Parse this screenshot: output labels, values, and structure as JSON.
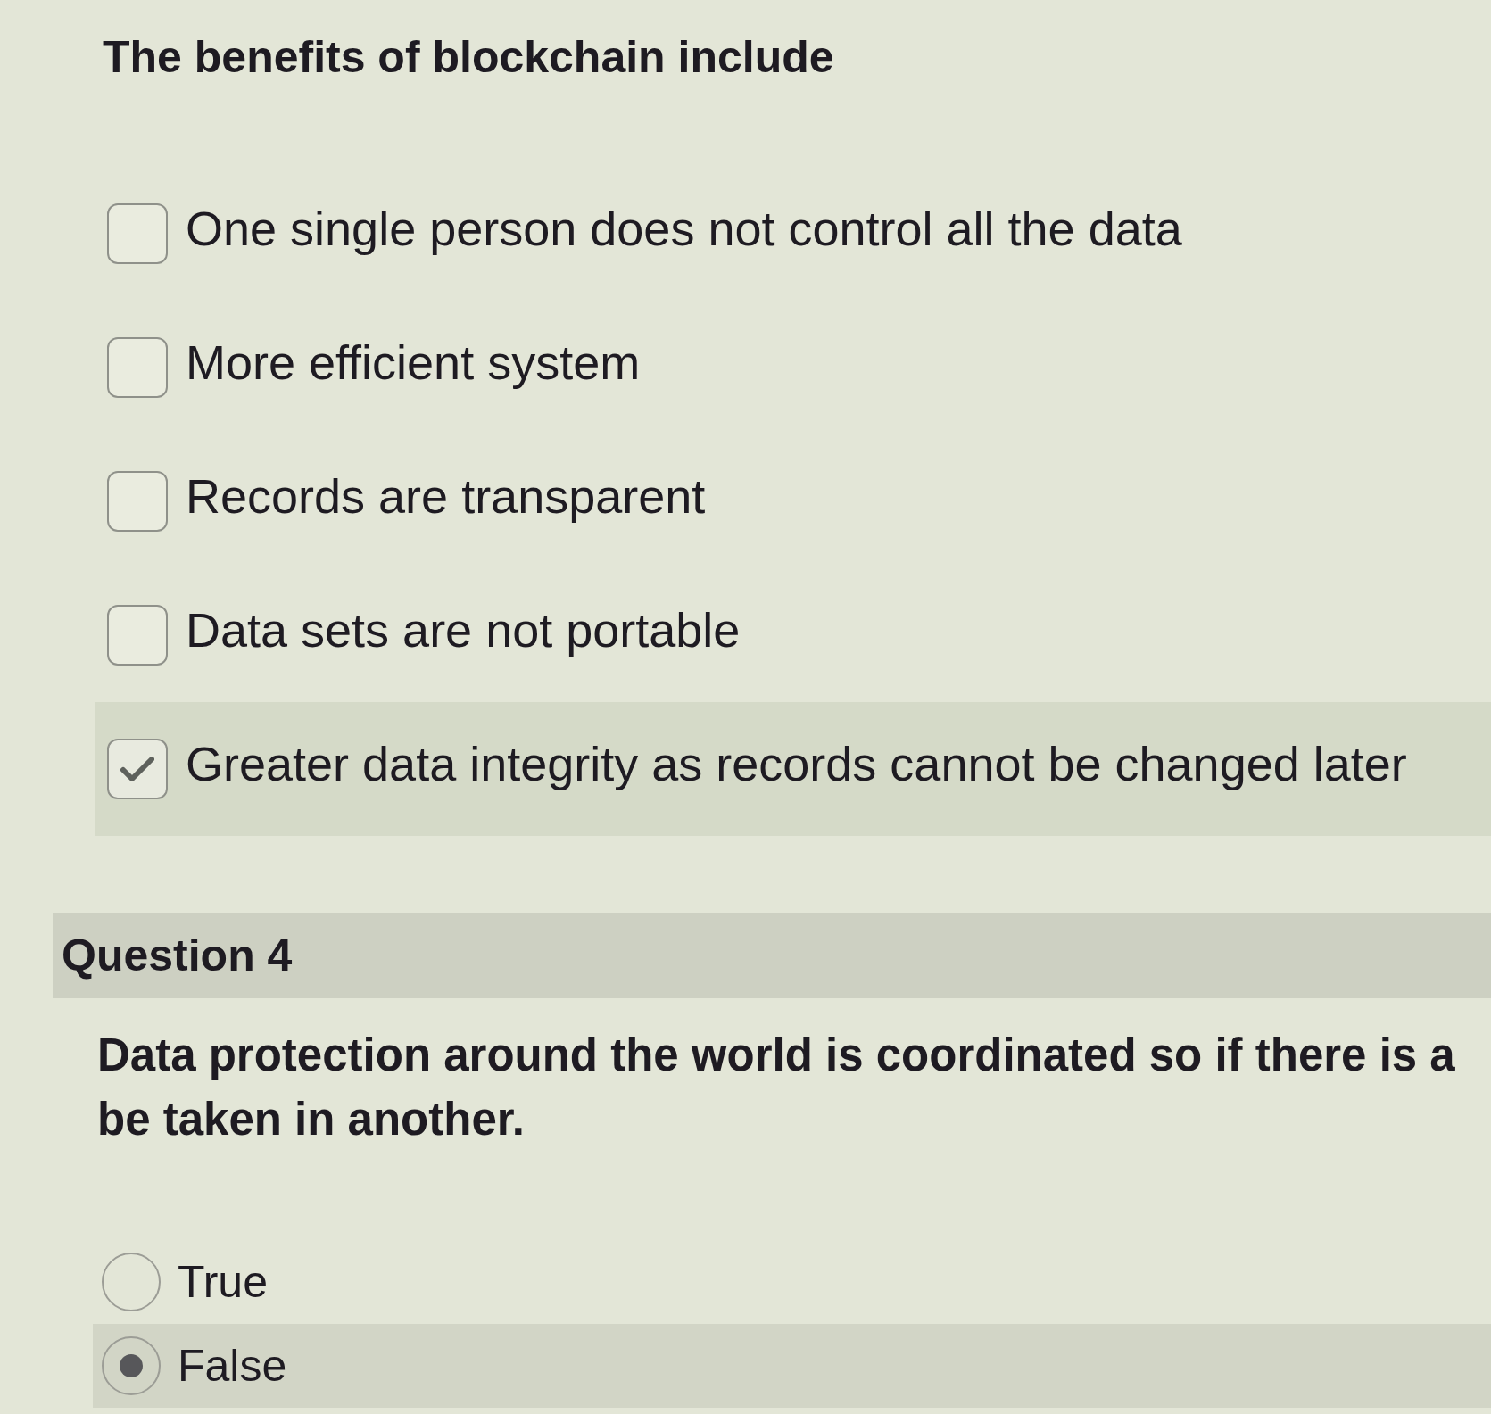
{
  "question_3": {
    "prompt": "The benefits of blockchain include",
    "options": [
      {
        "label": "One single person does not control all the data",
        "checked": false
      },
      {
        "label": "More efficient system",
        "checked": false
      },
      {
        "label": "Records are transparent",
        "checked": false
      },
      {
        "label": "Data sets are not portable",
        "checked": false
      },
      {
        "label": "Greater data integrity as records cannot be changed later",
        "checked": true
      }
    ]
  },
  "question_4": {
    "heading": "Question 4",
    "prompt_lines": [
      "Data protection around the world is coordinated so if there is a",
      "be taken in another."
    ],
    "options": [
      {
        "label": "True",
        "selected": false
      },
      {
        "label": "False",
        "selected": true
      }
    ]
  }
}
